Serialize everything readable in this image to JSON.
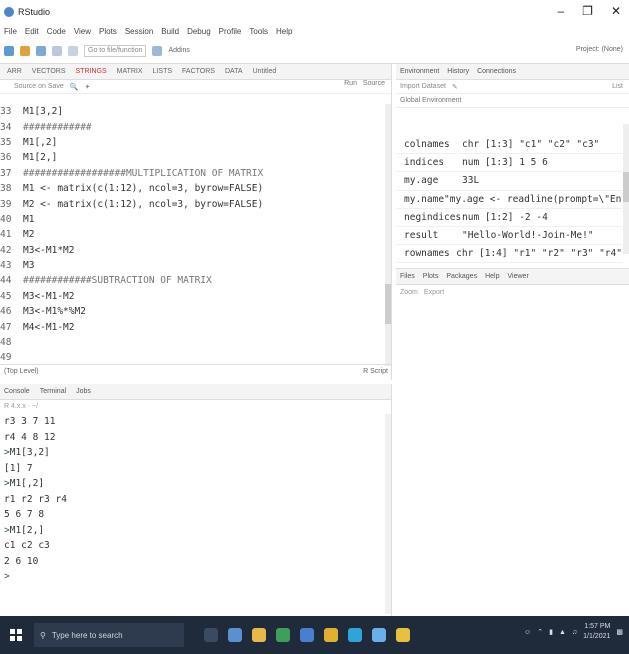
{
  "window": {
    "title": "RStudio",
    "controls": [
      "–",
      "❐",
      "✕"
    ]
  },
  "menu": [
    "File",
    "Edit",
    "Code",
    "View",
    "Plots",
    "Session",
    "Build",
    "Debug",
    "Profile",
    "Tools",
    "Help"
  ],
  "toolbar": {
    "goto_placeholder": "Go to file/function",
    "addins_label": "Addins",
    "project_label": "Project: (None)"
  },
  "editor": {
    "tabs": [
      "ARR",
      "VECTORS",
      "STRINGS",
      "MATRIX",
      "LISTS",
      "FACTORS",
      "DATA",
      "Untitled"
    ],
    "active_tab": "STRINGS",
    "toolbar": [
      "Source on Save"
    ],
    "right_tools": [
      "Run",
      "Source"
    ],
    "lines": [
      {
        "n": "33",
        "code": "M1[3,2]"
      },
      {
        "n": "34",
        "code": "############"
      },
      {
        "n": "35",
        "code": "M1[,2]"
      },
      {
        "n": "36",
        "code": "M1[2,]"
      },
      {
        "n": "37",
        "code": "##################MULTIPLICATION OF MATRIX"
      },
      {
        "n": "38",
        "code": "M1 <- matrix(c(1:12), ncol=3, byrow=FALSE)"
      },
      {
        "n": "39",
        "code": "M2 <- matrix(c(1:12), ncol=3, byrow=FALSE)"
      },
      {
        "n": "40",
        "code": "M1"
      },
      {
        "n": "41",
        "code": "M2"
      },
      {
        "n": "42",
        "code": "M3<-M1*M2"
      },
      {
        "n": "43",
        "code": "M3"
      },
      {
        "n": "44",
        "code": "############SUBTRACTION OF MATRIX"
      },
      {
        "n": "45",
        "code": "M3<-M1-M2"
      },
      {
        "n": "46",
        "code": "M3<-M1%*%M2"
      },
      {
        "n": "47",
        "code": "M4<-M1-M2"
      },
      {
        "n": "48",
        "code": ""
      },
      {
        "n": "49",
        "code": ""
      }
    ],
    "status_left": "(Top Level)",
    "status_right": "R Script"
  },
  "console": {
    "tabs": [
      "Console",
      "Terminal",
      "Jobs"
    ],
    "path": "R 4.x.x · ~/",
    "lines": [
      {
        "prompt": "",
        "text": "r3  3  7 11"
      },
      {
        "prompt": "",
        "text": "r4  4  8 12"
      },
      {
        "prompt": "> ",
        "text": "M1[3,2]"
      },
      {
        "prompt": "",
        "text": "[1] 7"
      },
      {
        "prompt": "> ",
        "text": "M1[,2]"
      },
      {
        "prompt": "",
        "text": "r1 r2 r3 r4"
      },
      {
        "prompt": "",
        "text": " 5  6  7  8"
      },
      {
        "prompt": "> ",
        "text": "M1[2,]"
      },
      {
        "prompt": "",
        "text": "c1 c2 c3"
      },
      {
        "prompt": "",
        "text": " 2  6 10"
      },
      {
        "prompt": "> ",
        "text": ""
      }
    ]
  },
  "environment": {
    "tabs": [
      "Environment",
      "History",
      "Connections"
    ],
    "toolbar": [
      "Import Dataset"
    ],
    "memory": "List",
    "scope": "Global Environment",
    "rows": [
      {
        "name": "colnames",
        "value": "chr [1:3] \"c1\" \"c2\" \"c3\""
      },
      {
        "name": "indices",
        "value": "num [1:3] 1 5 6"
      },
      {
        "name": "my.age",
        "value": "33L"
      },
      {
        "name": "my.name",
        "value": "\"my.age <- readline(prompt=\\\"Ente..."
      },
      {
        "name": "negindices",
        "value": "num [1:2] -2 -4"
      },
      {
        "name": "result",
        "value": "\"Hello-World!-Join-Me!\""
      },
      {
        "name": "rownames",
        "value": "chr [1:4] \"r1\" \"r2\" \"r3\" \"r4\""
      }
    ]
  },
  "files": {
    "tabs": [
      "Files",
      "Plots",
      "Packages",
      "Help",
      "Viewer"
    ],
    "toolbar": [
      "Zoom",
      "Export"
    ]
  },
  "taskbar": {
    "search_placeholder": "Type here to search",
    "time": "1:57 PM",
    "date": "1/1/2021"
  }
}
